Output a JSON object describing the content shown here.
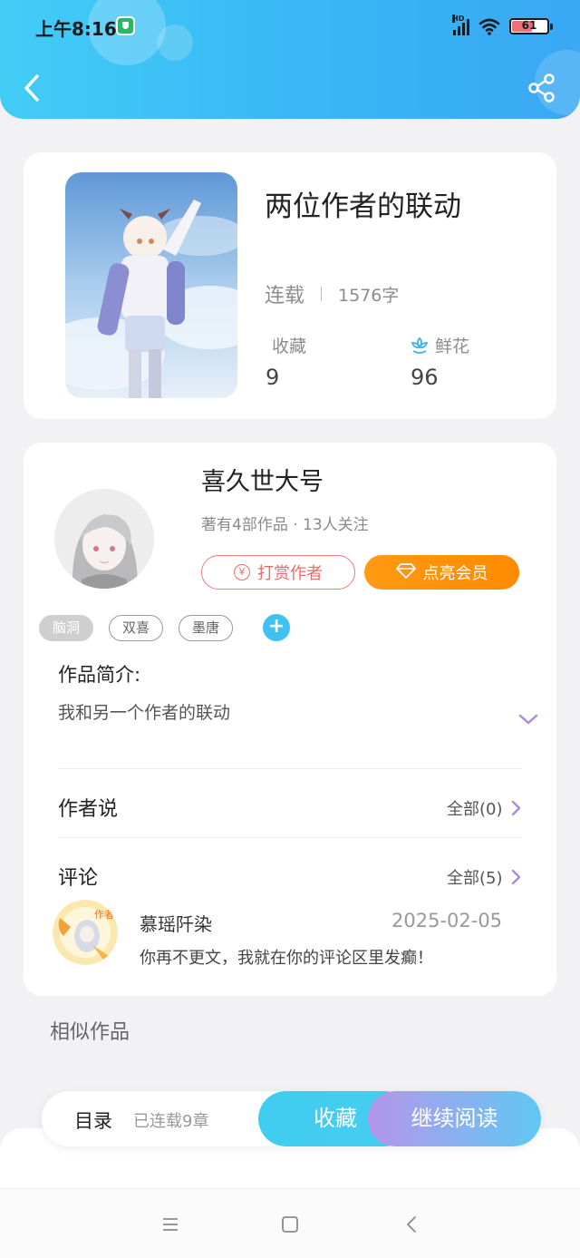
{
  "status_bar": {
    "time": "上午8:16",
    "network": "HD",
    "battery": "61",
    "battery_level": 0.61
  },
  "header": {
    "back_icon": "chevron-left-icon",
    "share_icon": "share-icon"
  },
  "book": {
    "title": "两位作者的联动",
    "status": "连载",
    "word_count": "1576字",
    "favorites_label": "收藏",
    "favorites_value": "9",
    "flowers_label": "鲜花",
    "flowers_value": "96"
  },
  "author": {
    "name": "喜久世大号",
    "meta": "著有4部作品 · 13人关注",
    "reward_label": "打赏作者",
    "vip_label": "点亮会员"
  },
  "tags": [
    "脑洞",
    "双喜",
    "墨唐"
  ],
  "intro": {
    "label": "作品简介:",
    "text": "我和另一个作者的联动"
  },
  "author_says": {
    "label": "作者说",
    "more": "全部(0)"
  },
  "comments": {
    "label": "评论",
    "more": "全部(5)",
    "first": {
      "user": "慕瑶阡染",
      "badge": "作者",
      "date": "2025-02-05",
      "text": "你再不更文，我就在你的评论区里发癫！"
    }
  },
  "similar_label": "相似作品",
  "bottom_bar": {
    "toc_label": "目录",
    "chapter_count": "已连载9章",
    "favorite_button": "收藏",
    "read_button": "继续阅读"
  },
  "colors": {
    "header_start": "#43cdf6",
    "header_end": "#3aa8f4",
    "vip_orange": "#ff9a12",
    "reward_red": "#ee6a6a",
    "accent_cyan": "#3ec2f2"
  }
}
